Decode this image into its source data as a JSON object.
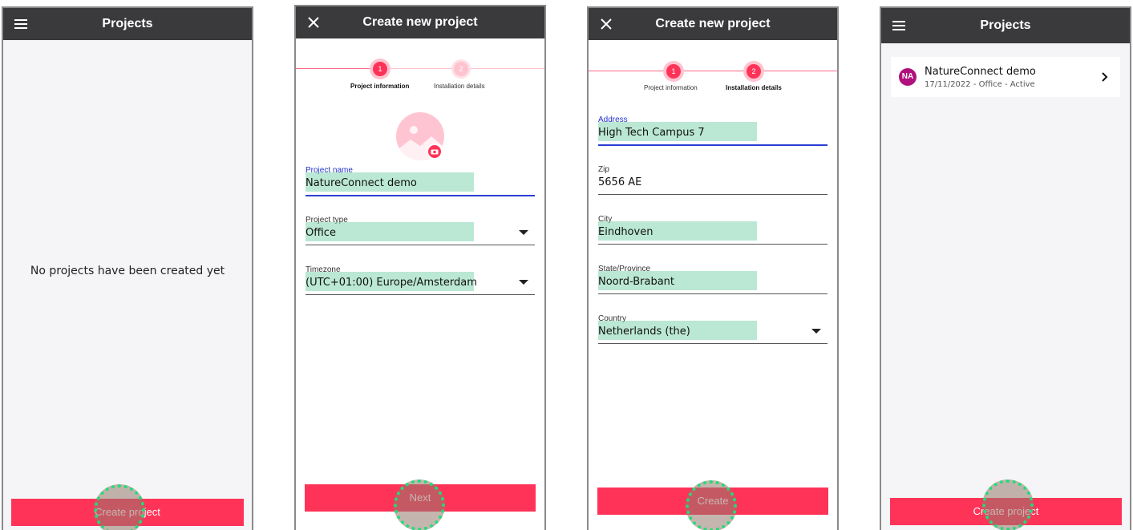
{
  "screen1": {
    "title": "Projects",
    "menu_icon": "hamburger-menu-icon",
    "empty_message": "No projects have been created yet",
    "create_button": "Create project"
  },
  "screen2": {
    "title": "Create new project",
    "close_icon": "close-icon",
    "steps": [
      {
        "number": "1",
        "label": "Project information",
        "active": true
      },
      {
        "number": "2",
        "label": "Installation details",
        "active": false
      }
    ],
    "image_placeholder_icon": "image-placeholder-icon",
    "camera_icon": "camera-icon",
    "fields": {
      "project_name": {
        "label": "Project name",
        "value": "NatureConnect demo"
      },
      "project_type": {
        "label": "Project type",
        "value": "Office"
      },
      "timezone": {
        "label": "Timezone",
        "value": "(UTC+01:00) Europe/Amsterdam"
      }
    },
    "next_button": "Next"
  },
  "screen3": {
    "title": "Create new project",
    "close_icon": "close-icon",
    "steps": [
      {
        "number": "1",
        "label": "Project information",
        "active": false
      },
      {
        "number": "2",
        "label": "Installation details",
        "active": true
      }
    ],
    "fields": {
      "address": {
        "label": "Address",
        "value": "High Tech Campus 7"
      },
      "zip": {
        "label": "Zip",
        "value": "5656 AE"
      },
      "city": {
        "label": "City",
        "value": "Eindhoven"
      },
      "state": {
        "label": "State/Province",
        "value": "Noord-Brabant"
      },
      "country": {
        "label": "Country",
        "value": "Netherlands (the)"
      }
    },
    "create_button": "Create"
  },
  "screen4": {
    "title": "Projects",
    "menu_icon": "hamburger-menu-icon",
    "project": {
      "initials": "NA",
      "name": "NatureConnect demo",
      "details": "17/11/2022 - Office - Active"
    },
    "create_button": "Create project"
  },
  "colors": {
    "accent": "#ff3358",
    "appbar": "#3a3a3c",
    "focus_blue": "#2b3fd4",
    "highlight_green": "#78d2aa",
    "tap_ring": "#22dd77",
    "badge": "#b0117e"
  }
}
